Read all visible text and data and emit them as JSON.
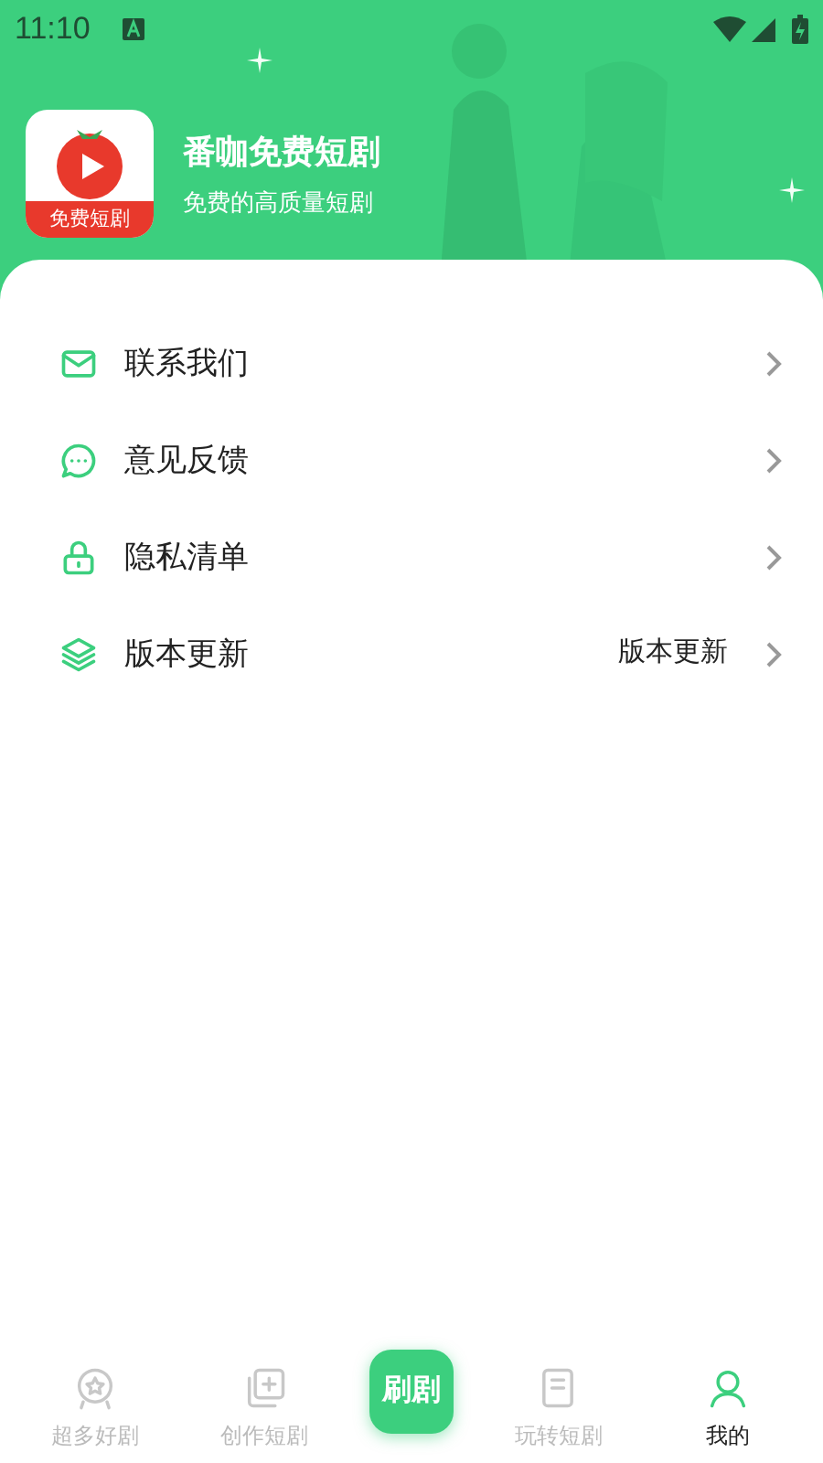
{
  "status_bar": {
    "time": "11:10"
  },
  "app": {
    "name": "番咖免费短剧",
    "tagline": "免费的高质量短剧",
    "logo_label": "免费短剧"
  },
  "menu": [
    {
      "kind": "mail",
      "label": "联系我们"
    },
    {
      "kind": "chat",
      "label": "意见反馈"
    },
    {
      "kind": "lock",
      "label": "隐私清单"
    },
    {
      "kind": "layers",
      "label": "版本更新",
      "value": "版本更新"
    }
  ],
  "tabs": [
    {
      "kind": "star",
      "label": "超多好剧",
      "selected": false
    },
    {
      "kind": "create",
      "label": "创作短剧",
      "selected": false
    },
    {
      "kind": "center",
      "label": "刷剧",
      "selected": false
    },
    {
      "kind": "book",
      "label": "玩转短剧",
      "selected": false
    },
    {
      "kind": "user",
      "label": "我的",
      "selected": true
    }
  ]
}
